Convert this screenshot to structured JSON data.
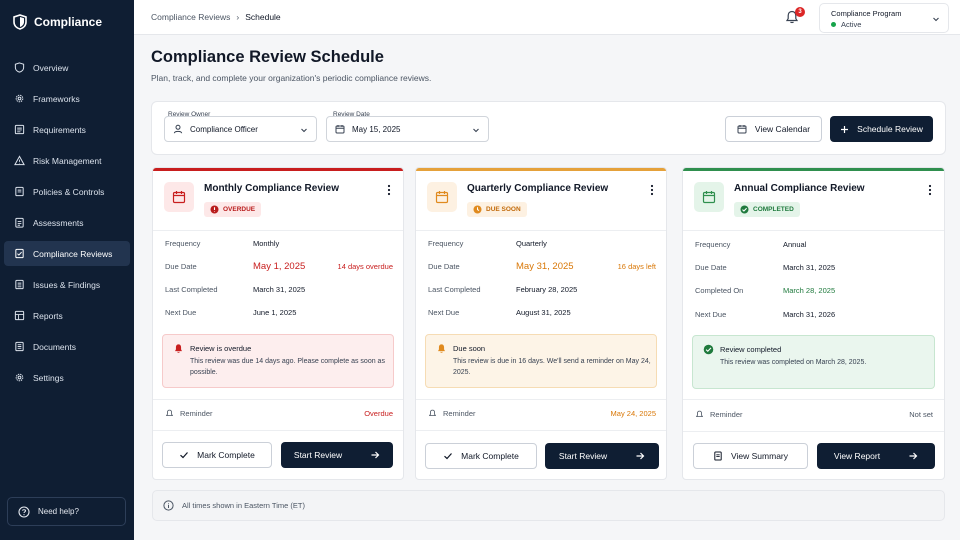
{
  "app": {
    "name": "Compliance"
  },
  "sidebar": {
    "items": [
      {
        "label": "Overview",
        "icon": "shield-icon"
      },
      {
        "label": "Frameworks",
        "icon": "gear-icon"
      },
      {
        "label": "Requirements",
        "icon": "list-icon"
      },
      {
        "label": "Risk Management",
        "icon": "warning-icon"
      },
      {
        "label": "Policies & Controls",
        "icon": "document-icon"
      },
      {
        "label": "Assessments",
        "icon": "clipboard-icon"
      },
      {
        "label": "Compliance Reviews",
        "icon": "review-icon",
        "active": true
      },
      {
        "label": "Issues & Findings",
        "icon": "issues-icon"
      },
      {
        "label": "Reports",
        "icon": "reports-icon"
      },
      {
        "label": "Documents",
        "icon": "folder-icon"
      },
      {
        "label": "Settings",
        "icon": "gear-icon"
      }
    ],
    "help": "Need help?"
  },
  "header": {
    "breadcrumb": [
      "Compliance Reviews",
      "Schedule"
    ],
    "notifications": "3",
    "program_title": "Compliance Program",
    "program_status": "Active"
  },
  "page": {
    "title": "Compliance Review Schedule",
    "subtitle": "Plan, track, and complete your organization's periodic compliance reviews."
  },
  "filters": {
    "owner_label": "Review Owner",
    "owner_value": "Compliance Officer",
    "date_label": "Review Date",
    "date_value": "May 15, 2025",
    "view_calendar": "View Calendar",
    "schedule_review": "Schedule Review"
  },
  "cards": [
    {
      "title": "Monthly Compliance Review",
      "accent": "#c81e1e",
      "badge": "OVERDUE",
      "badge_color": "#b91c1c",
      "badge_bg": "#fde8e8",
      "rows": [
        {
          "k": "Frequency",
          "v": "Monthly"
        },
        {
          "k": "Due Date",
          "v": "May 1, 2025",
          "x": "14 days overdue"
        },
        {
          "k": "Last Completed",
          "v": "March 31, 2025"
        },
        {
          "k": "Next Due",
          "v": "June 1, 2025"
        }
      ],
      "alert_title": "Review is overdue",
      "alert_body": "This review was due 14 days ago. Please complete as soon as possible.",
      "reminder_label": "Reminder",
      "reminder_value": "Overdue",
      "btn1": "Mark Complete",
      "btn2": "Start Review"
    },
    {
      "title": "Quarterly Compliance Review",
      "accent": "#e5a13a",
      "badge": "DUE SOON",
      "badge_color": "#c26a0a",
      "badge_bg": "#fdf1e2",
      "rows": [
        {
          "k": "Frequency",
          "v": "Quarterly"
        },
        {
          "k": "Due Date",
          "v": "May 31, 2025",
          "x": "16 days left"
        },
        {
          "k": "Last Completed",
          "v": "February 28, 2025"
        },
        {
          "k": "Next Due",
          "v": "August 31, 2025"
        }
      ],
      "alert_title": "Due soon",
      "alert_body": "This review is due in 16 days. We'll send a reminder on May 24, 2025.",
      "reminder_label": "Reminder",
      "reminder_value": "May 24, 2025",
      "btn1": "Mark Complete",
      "btn2": "Start Review"
    },
    {
      "title": "Annual Compliance Review",
      "accent": "#2f8f4e",
      "badge": "COMPLETED",
      "badge_color": "#1f7a3d",
      "badge_bg": "#e4f4e9",
      "rows": [
        {
          "k": "Frequency",
          "v": "Annual"
        },
        {
          "k": "Due Date",
          "v": "March 31, 2025"
        },
        {
          "k": "Completed On",
          "v": "March 28, 2025"
        },
        {
          "k": "Next Due",
          "v": "March 31, 2026"
        }
      ],
      "alert_title": "Review completed",
      "alert_body": "This review was completed on March 28, 2025.",
      "reminder_label": "Reminder",
      "reminder_value": "Not set",
      "btn1": "View Summary",
      "btn2": "View Report"
    }
  ],
  "footer": {
    "note": "All times shown in Eastern Time (ET)"
  }
}
